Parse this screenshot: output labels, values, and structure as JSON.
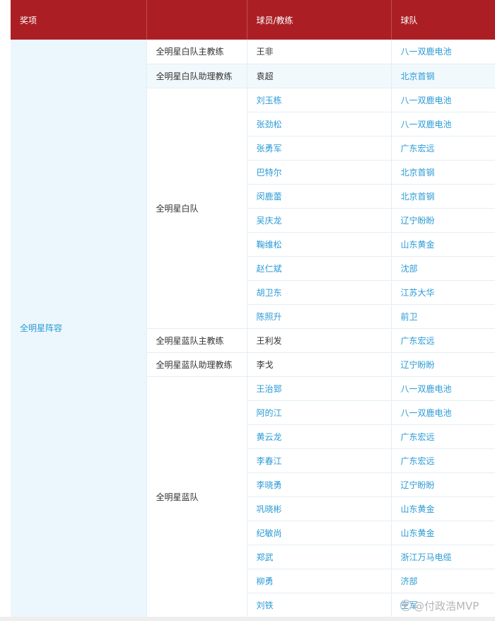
{
  "table": {
    "headers": [
      "奖项",
      "",
      "球员/教练",
      "球队"
    ],
    "award": "全明星阵容",
    "groups": [
      {
        "role": "全明星白队主教练",
        "shaded": false,
        "rows": [
          {
            "person": "王非",
            "team": "八一双鹿电池",
            "person_link": false
          }
        ]
      },
      {
        "role": "全明星白队助理教练",
        "shaded": true,
        "rows": [
          {
            "person": "袁超",
            "team": "北京首钢",
            "person_link": false
          }
        ]
      },
      {
        "role": "全明星白队",
        "shaded": false,
        "rows": [
          {
            "person": "刘玉栋",
            "team": "八一双鹿电池",
            "person_link": true
          },
          {
            "person": "张劲松",
            "team": "八一双鹿电池",
            "person_link": true
          },
          {
            "person": "张勇军",
            "team": "广东宏远",
            "person_link": true
          },
          {
            "person": "巴特尔",
            "team": "北京首钢",
            "person_link": true
          },
          {
            "person": "闵鹿蕾",
            "team": "北京首钢",
            "person_link": true
          },
          {
            "person": "吴庆龙",
            "team": "辽宁盼盼",
            "person_link": true
          },
          {
            "person": "鞠维松",
            "team": "山东黄金",
            "person_link": true
          },
          {
            "person": "赵仁斌",
            "team": "沈部",
            "person_link": true
          },
          {
            "person": "胡卫东",
            "team": "江苏大华",
            "person_link": true
          },
          {
            "person": "陈照升",
            "team": "前卫",
            "person_link": true
          }
        ]
      },
      {
        "role": "全明星蓝队主教练",
        "shaded": false,
        "rows": [
          {
            "person": "王利发",
            "team": "广东宏远",
            "person_link": false
          }
        ]
      },
      {
        "role": "全明星蓝队助理教练",
        "shaded": false,
        "rows": [
          {
            "person": "李戈",
            "team": "辽宁盼盼",
            "person_link": false
          }
        ]
      },
      {
        "role": "全明星蓝队",
        "shaded": false,
        "rows": [
          {
            "person": "王治郅",
            "team": "八一双鹿电池",
            "person_link": true
          },
          {
            "person": "阿的江",
            "team": "八一双鹿电池",
            "person_link": true
          },
          {
            "person": "黄云龙",
            "team": "广东宏远",
            "person_link": true
          },
          {
            "person": "李春江",
            "team": "广东宏远",
            "person_link": true
          },
          {
            "person": "李晓勇",
            "team": "辽宁盼盼",
            "person_link": true
          },
          {
            "person": "巩晓彬",
            "team": "山东黄金",
            "person_link": true
          },
          {
            "person": "纪敏尚",
            "team": "山东黄金",
            "person_link": true
          },
          {
            "person": "郑武",
            "team": "浙江万马电缆",
            "person_link": true
          },
          {
            "person": "柳勇",
            "team": "济部",
            "person_link": true
          },
          {
            "person": "刘铁",
            "team": "空军",
            "person_link": true
          }
        ]
      }
    ]
  },
  "watermark": {
    "text": "@付政浩MVP",
    "icon": "weibo-icon"
  },
  "colors": {
    "header_bg": "#ab1f24",
    "link": "#2a9ad6",
    "award_bg": "#ecf7fd"
  }
}
